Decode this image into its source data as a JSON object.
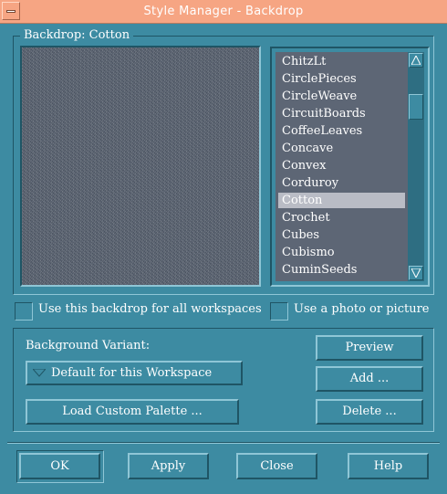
{
  "window": {
    "title": "Style Manager - Backdrop"
  },
  "backdrop_frame": {
    "label": "Backdrop: Cotton"
  },
  "backdrop_list": {
    "items": [
      "ChitzLt",
      "CirclePieces",
      "CircleWeave",
      "CircuitBoards",
      "CoffeeLeaves",
      "Concave",
      "Convex",
      "Corduroy",
      "Cotton",
      "Crochet",
      "Cubes",
      "Cubismo",
      "CuminSeeds"
    ],
    "selected": "Cotton"
  },
  "options": {
    "all_workspaces_label": "Use this backdrop for all workspaces",
    "photo_label": "Use a photo or picture"
  },
  "variant": {
    "label": "Background Variant:",
    "selected": "Default for this Workspace"
  },
  "buttons": {
    "load_palette": "Load Custom Palette ...",
    "preview": "Preview",
    "add": "Add ...",
    "delete": "Delete ...",
    "ok": "OK",
    "apply": "Apply",
    "close": "Close",
    "help": "Help"
  },
  "colors": {
    "background": "#3d8ba2",
    "titlebar": "#f6a583",
    "list_background": "#5d6675",
    "selection": "#b9bcc5"
  }
}
